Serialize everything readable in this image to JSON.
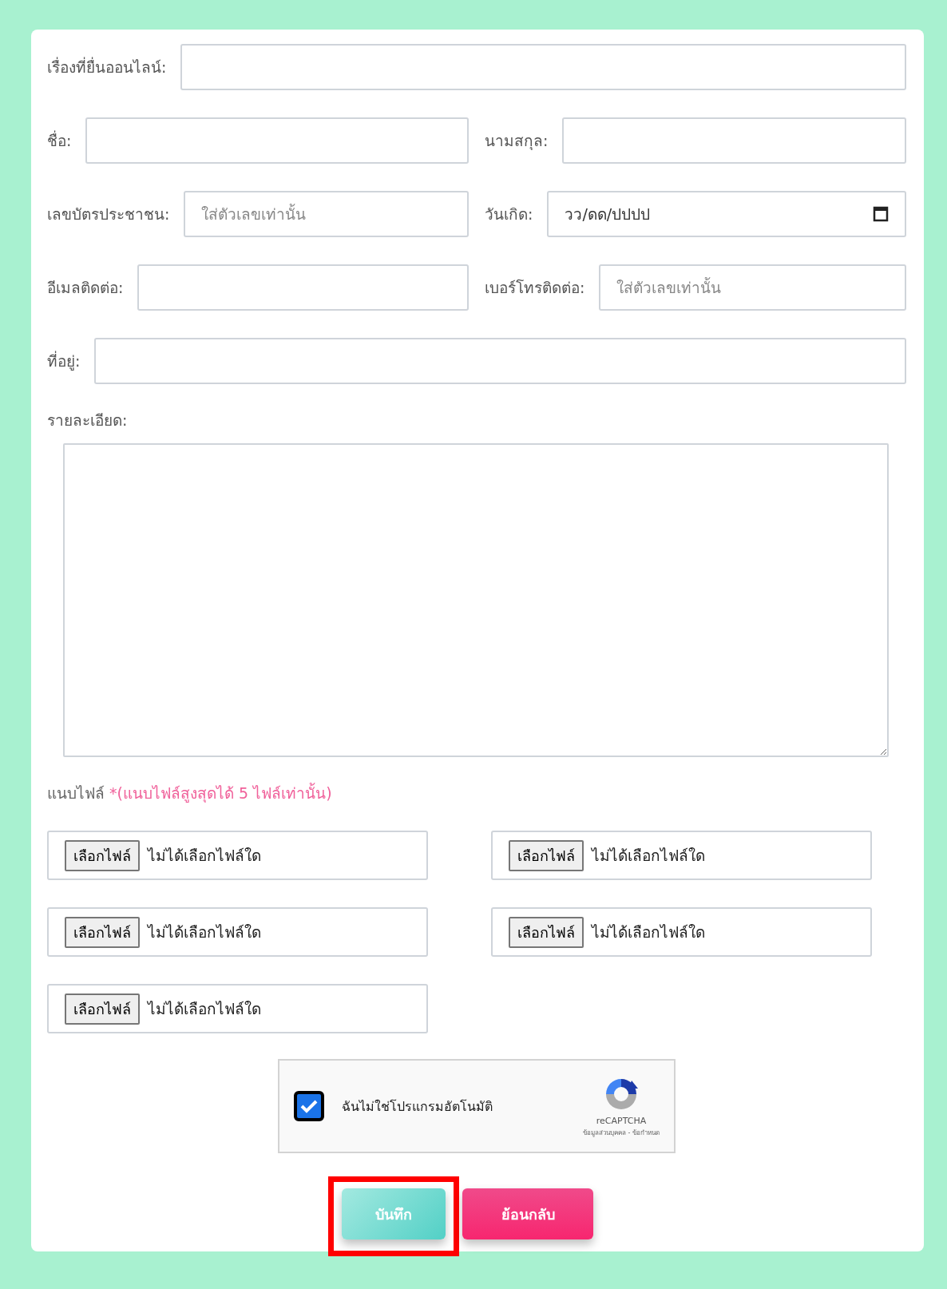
{
  "form": {
    "rows": [
      {
        "fields": [
          {
            "kind": "text",
            "label": "เรื่องที่ยื่นออนไลน์:"
          }
        ]
      },
      {
        "fields": [
          {
            "kind": "text",
            "label": "ชื่อ:"
          },
          {
            "kind": "text",
            "label": "นามสกุล:"
          }
        ]
      },
      {
        "fields": [
          {
            "kind": "text",
            "label": "เลขบัตรประชาชน:",
            "placeholder": "ใส่ตัวเลขเท่านั้น"
          },
          {
            "kind": "date",
            "label": "วันเกิด:",
            "value": "วว/ดด/ปปปป"
          }
        ]
      },
      {
        "fields": [
          {
            "kind": "text",
            "label": "อีเมลติดต่อ:"
          },
          {
            "kind": "text",
            "label": "เบอร์โทรติดต่อ:",
            "placeholder": "ใส่ตัวเลขเท่านั้น"
          }
        ]
      },
      {
        "fields": [
          {
            "kind": "text",
            "label": "ที่อยู่:"
          }
        ]
      }
    ],
    "details_label": "รายละเอียด:",
    "attachments": {
      "label": "แนบไฟล์",
      "note": "*(แนบไฟล์สูงสุดได้ 5 ไฟล์เท่านั้น)",
      "files": [
        {
          "button": "เลือกไฟล์",
          "status": "ไม่ได้เลือกไฟล์ใด"
        },
        {
          "button": "เลือกไฟล์",
          "status": "ไม่ได้เลือกไฟล์ใด"
        },
        {
          "button": "เลือกไฟล์",
          "status": "ไม่ได้เลือกไฟล์ใด"
        },
        {
          "button": "เลือกไฟล์",
          "status": "ไม่ได้เลือกไฟล์ใด"
        },
        {
          "button": "เลือกไฟล์",
          "status": "ไม่ได้เลือกไฟล์ใด"
        }
      ]
    },
    "captcha": {
      "label": "ฉันไม่ใช่โปรแกรมอัตโนมัติ",
      "checked": true,
      "brand": "reCAPTCHA",
      "links": "ข้อมูลส่วนบุคคล - ข้อกำหนด"
    },
    "buttons": [
      {
        "kind": "save",
        "label": "บันทึก",
        "highlighted": true
      },
      {
        "kind": "back",
        "label": "ย้อนกลับ",
        "highlighted": false
      }
    ]
  }
}
